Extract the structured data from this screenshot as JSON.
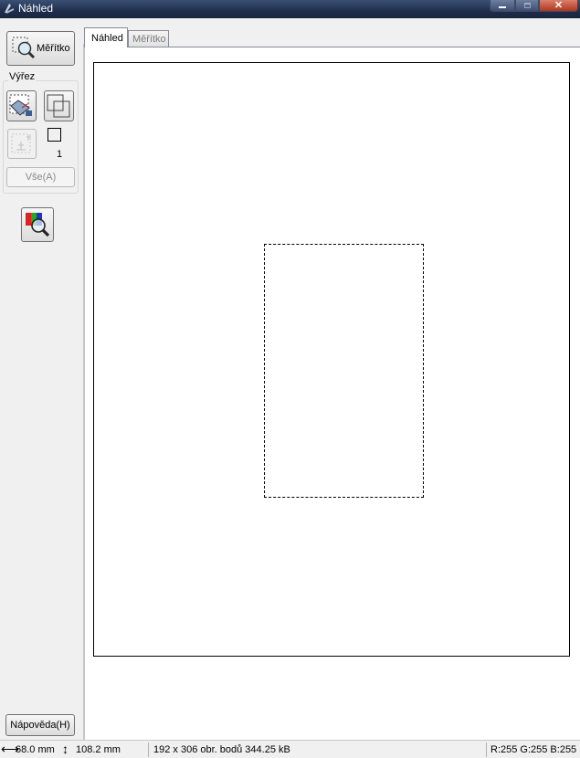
{
  "window": {
    "title": "Náhled"
  },
  "sidebar": {
    "scale_button_label": "Měřítko",
    "group_label": "Výřez",
    "marquee_count": "1",
    "all_button_label": "Vše(A)",
    "help_button_label": "Nápověda(H)"
  },
  "tabs": [
    {
      "label": "Náhled",
      "active": true
    },
    {
      "label": "Měřítko",
      "active": false
    }
  ],
  "status": {
    "width_value": "68.0 mm",
    "height_value": "108.2 mm",
    "image_info": "192 x 306 obr. bodů 344.25 kB",
    "rgb": "R:255 G:255 B:255"
  },
  "icons": {
    "app": "scanner-icon",
    "scale": "magnifier-icon",
    "auto_locate": "auto-locate-icon",
    "marquee": "duplicate-marquee-icon",
    "disabled": "delete-marquee-icon",
    "color": "color-palette-icon",
    "width": "horizontal-arrows-icon",
    "height": "vertical-arrows-icon"
  }
}
